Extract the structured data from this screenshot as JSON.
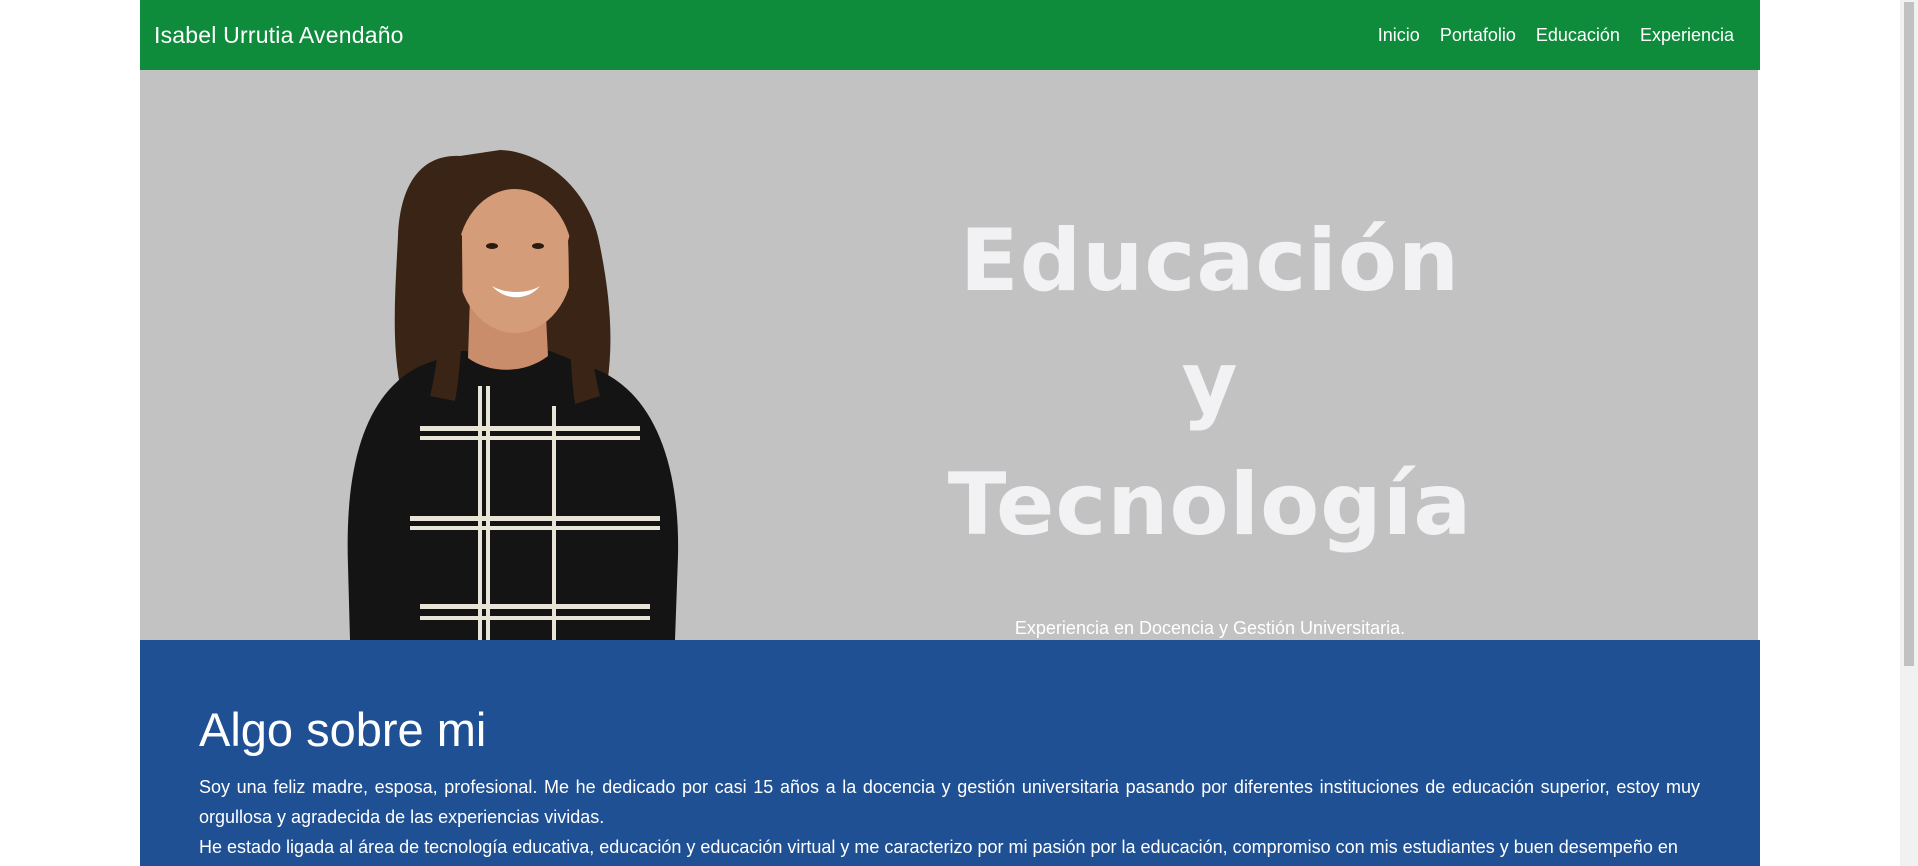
{
  "navbar": {
    "brand": "Isabel Urrutia Avendaño",
    "links": [
      "Inicio",
      "Portafolio",
      "Educación",
      "Experiencia"
    ]
  },
  "hero": {
    "title_line1": "Educación y",
    "title_line2": "Tecnología",
    "subtitle": "Experiencia en Docencia y Gestión Universitaria.",
    "portrait_icon": "portrait-photo"
  },
  "about": {
    "heading": "Algo sobre mi",
    "paragraph1": "Soy una feliz madre, esposa, profesional. Me he dedicado por casi 15 años a la docencia y gestión universitaria pasando por diferentes instituciones de educación superior, estoy muy orgullosa y agradecida de las experiencias vividas.",
    "paragraph2": "He estado ligada al área de tecnología educativa, educación y educación virtual y me caracterizo por mi pasión por la educación, compromiso con mis estudiantes y buen desempeño en"
  },
  "colors": {
    "navbar": "#0e8c3c",
    "hero_bg": "#c2c2c2",
    "about_bg": "#1f5094"
  }
}
